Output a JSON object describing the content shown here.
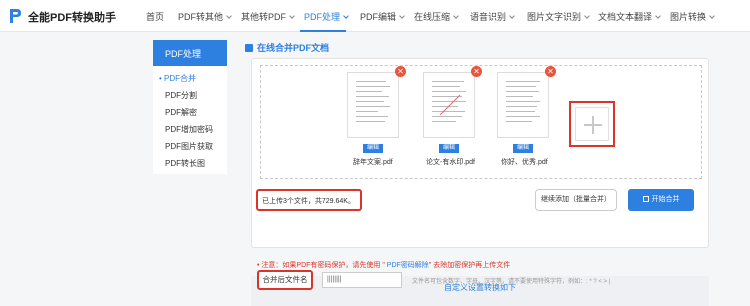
{
  "brand": "全能PDF转换助手",
  "nav": [
    {
      "label": "首页",
      "dropdown": false
    },
    {
      "label": "PDF转其他",
      "dropdown": true
    },
    {
      "label": "其他转PDF",
      "dropdown": true
    },
    {
      "label": "PDF处理",
      "dropdown": true,
      "active": true
    },
    {
      "label": "PDF编辑",
      "dropdown": true
    },
    {
      "label": "在线压缩",
      "dropdown": true
    },
    {
      "label": "语音识别",
      "dropdown": true
    },
    {
      "label": "图片文字识别",
      "dropdown": true
    },
    {
      "label": "文档文本翻译",
      "dropdown": true
    },
    {
      "label": "图片转换",
      "dropdown": true
    }
  ],
  "sidebar": {
    "header": "PDF处理",
    "items": [
      {
        "label": "• PDF合并",
        "active": true
      },
      {
        "label": "PDF分割"
      },
      {
        "label": "PDF解密"
      },
      {
        "label": "PDF增加密码"
      },
      {
        "label": "PDF图片获取"
      },
      {
        "label": "PDF转长图"
      }
    ]
  },
  "main": {
    "title": "在线合并PDF文档",
    "files": [
      {
        "name": "辞年文案.pdf",
        "edit_label": "编辑"
      },
      {
        "name": "论文-有水印.pdf",
        "edit_label": "编辑"
      },
      {
        "name": "你好、优秀.pdf",
        "edit_label": "编辑"
      }
    ],
    "delete_glyph": "✕",
    "upload_count": "已上传3个文件，共729.64K。",
    "continue_label": "继续添加（批量合并）",
    "start_label": "开始合并",
    "notice_prefix": "• 注意：如果PDF有密码保护，请先使用 \"",
    "notice_link": " PDF密码解除",
    "notice_suffix": "\" 去除加密保护再上传文件",
    "settings_title": "自定义设置转换如下",
    "filename_label": "合并后文件名",
    "filename_value": "||||||||",
    "filename_hint": "文件名可包含数字、字母、汉字等，请不要使用特殊字符，例如：: * ? < > |"
  },
  "colors": {
    "accent": "#2d7fe0",
    "highlight": "#d9352a"
  }
}
